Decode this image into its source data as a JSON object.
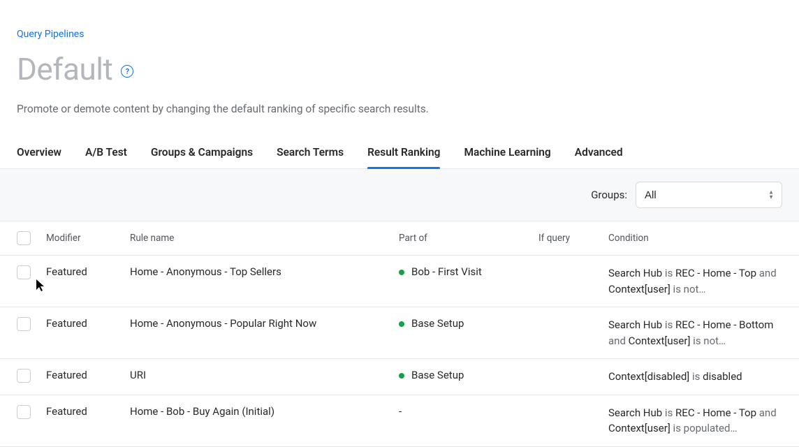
{
  "breadcrumb": {
    "label": "Query Pipelines"
  },
  "title": "Default",
  "help_aria": "?",
  "description": "Promote or demote content by changing the default ranking of specific search results.",
  "tabs": [
    {
      "label": "Overview",
      "active": false
    },
    {
      "label": "A/B Test",
      "active": false
    },
    {
      "label": "Groups & Campaigns",
      "active": false
    },
    {
      "label": "Search Terms",
      "active": false
    },
    {
      "label": "Result Ranking",
      "active": true
    },
    {
      "label": "Machine Learning",
      "active": false
    },
    {
      "label": "Advanced",
      "active": false
    }
  ],
  "groups": {
    "label": "Groups:",
    "value": "All"
  },
  "table": {
    "headers": {
      "modifier": "Modifier",
      "rule_name": "Rule name",
      "part_of": "Part of",
      "if_query": "If query",
      "condition": "Condition"
    },
    "rows": [
      {
        "modifier": "Featured",
        "rule_name": "Home - Anonymous - Top Sellers",
        "part_of": "Bob - First Visit",
        "part_of_status": "green",
        "if_query": "",
        "condition_html": "<b>Search Hub</b> is <b>REC - Home - Top</b> and <b>Context[user]</b> is not…"
      },
      {
        "modifier": "Featured",
        "rule_name": "Home - Anonymous - Popular Right Now",
        "part_of": "Base Setup",
        "part_of_status": "green",
        "if_query": "",
        "condition_html": "<b>Search Hub</b> is <b>REC - Home - Bottom</b> and <b>Context[user]</b> is not…"
      },
      {
        "modifier": "Featured",
        "rule_name": "URI",
        "part_of": "Base Setup",
        "part_of_status": "green",
        "if_query": "",
        "condition_html": "<b>Context[disabled]</b> is <b>disabled</b>"
      },
      {
        "modifier": "Featured",
        "rule_name": "Home - Bob - Buy Again (Initial)",
        "part_of": "-",
        "part_of_status": "",
        "if_query": "",
        "condition_html": "<b>Search Hub</b> is <b>REC - Home - Top</b> and <b>Context[user]</b> is populated…"
      }
    ]
  }
}
